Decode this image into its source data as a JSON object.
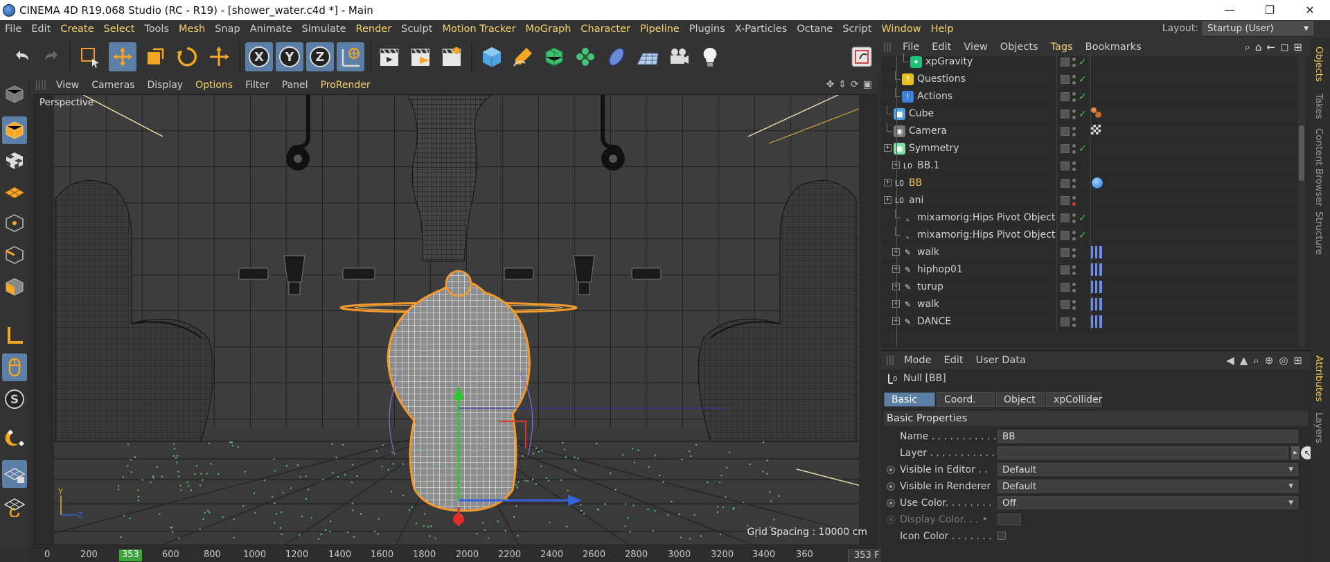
{
  "window": {
    "title": "CINEMA 4D R19.068 Studio (RC - R19) - [shower_water.c4d *] - Main",
    "minimize": "—",
    "restore": "❐",
    "close": "✕"
  },
  "menu": {
    "items": [
      "File",
      "Edit",
      "Create",
      "Select",
      "Tools",
      "Mesh",
      "Snap",
      "Animate",
      "Simulate",
      "Render",
      "Sculpt",
      "Motion Tracker",
      "MoGraph",
      "Character",
      "Pipeline",
      "Plugins",
      "X-Particles",
      "Octane",
      "Script",
      "Window",
      "Help"
    ],
    "layout_label": "Layout:",
    "layout_value": "Startup (User)"
  },
  "viewport": {
    "menu": [
      "View",
      "Cameras",
      "Display",
      "Options",
      "Filter",
      "Panel",
      "ProRender"
    ],
    "label": "Perspective",
    "grid_spacing": "Grid Spacing : 10000 cm",
    "axis_y": "Y",
    "axis_z": "Z"
  },
  "timeline": {
    "ticks": [
      "0",
      "200",
      "600",
      "800",
      "1000",
      "1200",
      "1400",
      "1600",
      "1800",
      "2000",
      "2200",
      "2400",
      "2600",
      "2800",
      "3000",
      "3200",
      "3400",
      "360"
    ],
    "current": "353",
    "frame_field": "353 F"
  },
  "object_manager": {
    "menu": [
      "File",
      "Edit",
      "View",
      "Objects",
      "Tags",
      "Bookmarks"
    ],
    "objects": [
      {
        "name": "xpGravity",
        "icon": "xp-gravity-icon"
      },
      {
        "name": "Questions",
        "icon": "xp-questions-icon"
      },
      {
        "name": "Actions",
        "icon": "xp-actions-icon"
      },
      {
        "name": "Cube",
        "icon": "cube-icon"
      },
      {
        "name": "Camera",
        "icon": "camera-icon"
      },
      {
        "name": "Symmetry",
        "icon": "symmetry-icon"
      },
      {
        "name": "BB.1",
        "icon": "null-icon"
      },
      {
        "name": "BB",
        "icon": "null-icon"
      },
      {
        "name": "ani",
        "icon": "null-icon"
      },
      {
        "name": "mixamorig:Hips Pivot Object",
        "icon": "joint-icon"
      },
      {
        "name": "mixamorig:Hips Pivot Object",
        "icon": "joint-icon"
      },
      {
        "name": "walk",
        "icon": "bone-icon"
      },
      {
        "name": "hiphop01",
        "icon": "bone-icon"
      },
      {
        "name": "turup",
        "icon": "bone-icon"
      },
      {
        "name": "walk",
        "icon": "bone-icon"
      },
      {
        "name": "DANCE",
        "icon": "bone-icon"
      }
    ]
  },
  "attributes": {
    "menu": [
      "Mode",
      "Edit",
      "User Data"
    ],
    "object_title": "Null [BB]",
    "tabs": [
      "Basic",
      "Coord.",
      "Object",
      "xpCollider"
    ],
    "section": "Basic Properties",
    "fields": {
      "name_label": "Name . . . . . . . . . . .",
      "name_value": "BB",
      "layer_label": "Layer . . . . . . . . . . .",
      "vis_editor_label": "Visible in Editor . .",
      "vis_editor_value": "Default",
      "vis_render_label": "Visible in Renderer",
      "vis_render_value": "Default",
      "use_color_label": "Use Color. . . . . . . .",
      "use_color_value": "Off",
      "display_color_label": "Display Color. . .",
      "icon_color_label": "Icon Color . . . . . . ."
    }
  },
  "side_tabs": [
    "Objects",
    "Takes",
    "Content Browser",
    "Structure",
    "Attributes",
    "Layers"
  ],
  "colors": {
    "accent": "#5b7fa6",
    "highlight": "#f5d46e",
    "check": "#3ecb3e",
    "wire": "#ffffff",
    "selection_outline": "#f59a2a"
  }
}
